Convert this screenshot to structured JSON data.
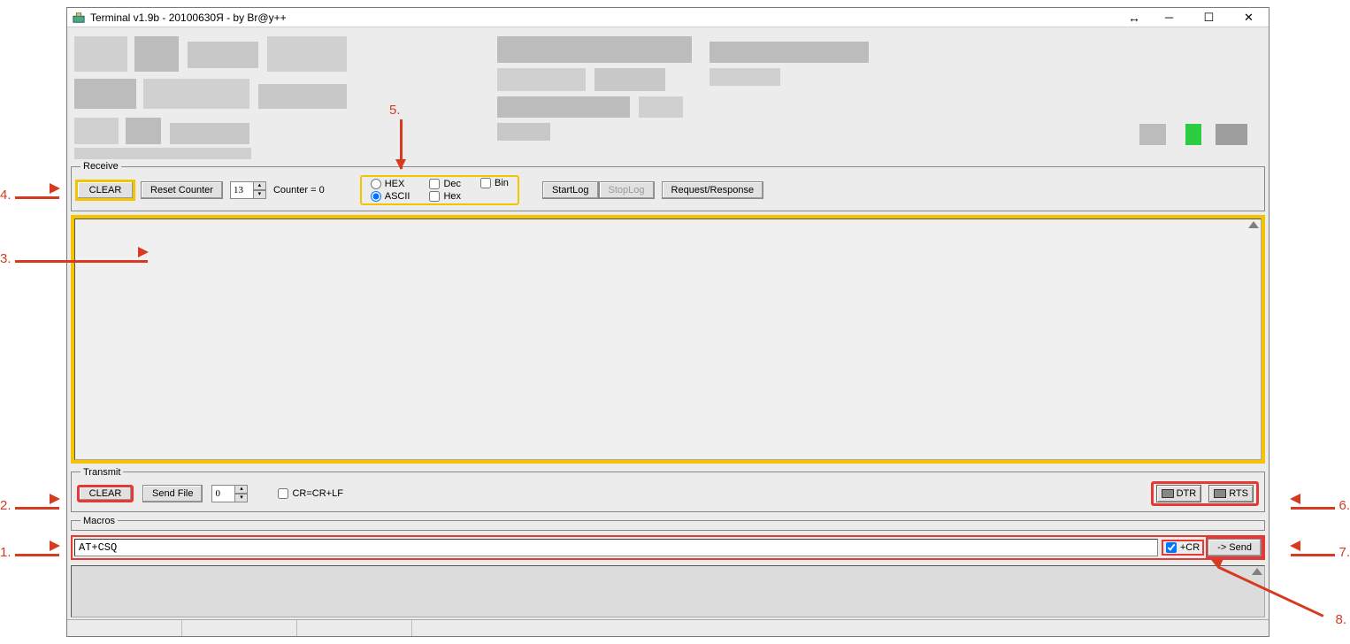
{
  "window": {
    "title": "Terminal v1.9b - 20100630Я - by Br@y++"
  },
  "receive": {
    "legend": "Receive",
    "clear": "CLEAR",
    "reset_counter": "Reset Counter",
    "counter_value": "13",
    "counter_label": "Counter =  0",
    "hex": "HEX",
    "ascii": "ASCII",
    "dec": "Dec",
    "hex2": "Hex",
    "bin": "Bin",
    "startlog": "StartLog",
    "stoplog": "StopLog",
    "reqres": "Request/Response"
  },
  "transmit": {
    "legend": "Transmit",
    "clear": "CLEAR",
    "send_file": "Send File",
    "spin_value": "0",
    "crcrlf": "CR=CR+LF",
    "dtr": "DTR",
    "rts": "RTS"
  },
  "macros": {
    "legend": "Macros"
  },
  "command": {
    "value": "AT+CSQ",
    "cr_label": "+CR",
    "send": "-> Send"
  },
  "annotations": {
    "a1": "1.",
    "a2": "2.",
    "a3": "3.",
    "a4": "4.",
    "a5": "5.",
    "a6": "6.",
    "a7": "7.",
    "a8": "8."
  }
}
